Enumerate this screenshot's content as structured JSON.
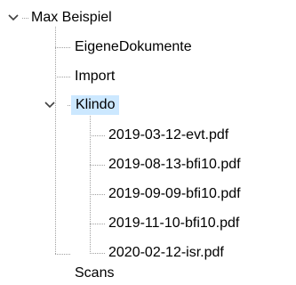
{
  "tree": {
    "root": {
      "label": "Max Beispiel",
      "expanded": true,
      "children": [
        {
          "label": "EigeneDokumente"
        },
        {
          "label": "Import"
        },
        {
          "label": "Klindo",
          "expanded": true,
          "selected": true,
          "children": [
            {
              "label": "2019-03-12-evt.pdf"
            },
            {
              "label": "2019-08-13-bfi10.pdf"
            },
            {
              "label": "2019-09-09-bfi10.pdf"
            },
            {
              "label": "2019-11-10-bfi10.pdf"
            },
            {
              "label": "2020-02-12-isr.pdf"
            }
          ]
        },
        {
          "label": "Scans"
        }
      ]
    }
  },
  "colors": {
    "selection": "#cce8ff",
    "guide_lines": "#a0a0a0",
    "chevron": "#404040",
    "text": "#000000"
  },
  "icons": {
    "expanded": "chevron-down-icon"
  }
}
